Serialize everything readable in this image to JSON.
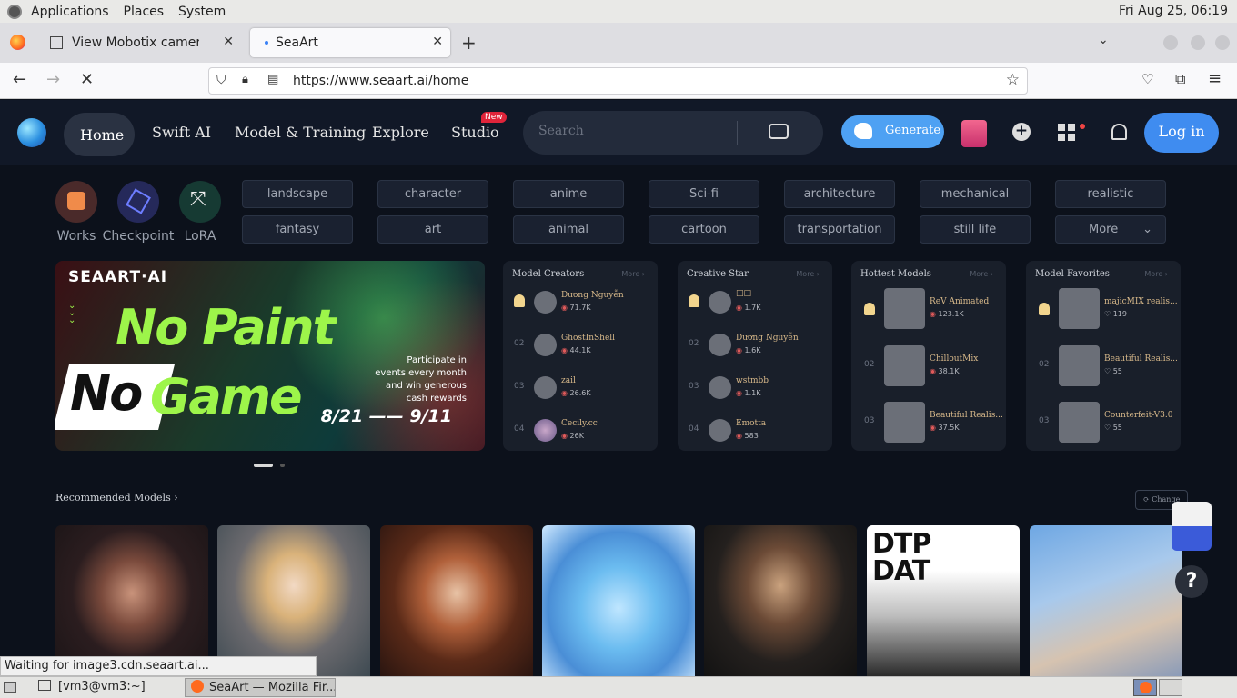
{
  "desktop": {
    "menus": [
      "Applications",
      "Places",
      "System"
    ],
    "clock": "Fri Aug 25, 06:19"
  },
  "browser": {
    "tabs": [
      {
        "title": "View Mobotix camera in Bul"
      },
      {
        "title": "SeaArt"
      }
    ],
    "url": "https://www.seaart.ai/home",
    "status": "Waiting for image3.cdn.seaart.ai..."
  },
  "site": {
    "nav": [
      "Home",
      "Swift AI",
      "Model & Training",
      "Explore",
      "Studio"
    ],
    "new_badge": "New",
    "search_placeholder": "Search",
    "generate": "Generate",
    "login": "Log in",
    "categories": [
      "Works",
      "Checkpoint",
      "LoRA"
    ],
    "tags_row1": [
      "landscape",
      "character",
      "anime",
      "Sci-fi",
      "architecture",
      "mechanical",
      "realistic"
    ],
    "tags_row2": [
      "fantasy",
      "art",
      "animal",
      "cartoon",
      "transportation",
      "still life",
      "More"
    ],
    "banner": {
      "brand": "SEAART·AI",
      "line1": "No Paint",
      "line2a": "No",
      "line2b": "Game",
      "blurb1": "Participate in",
      "blurb2": "events every month",
      "blurb3": "and win generous",
      "blurb4": "cash rewards",
      "dates": "8/21 —— 9/11"
    },
    "panels": [
      {
        "title": "Model Creators",
        "more": "More",
        "rows": [
          {
            "rank": "",
            "name": "Dương Nguyễn",
            "stat": "71.7K"
          },
          {
            "rank": "02",
            "name": "GhostInShell",
            "stat": "44.1K"
          },
          {
            "rank": "03",
            "name": "zail",
            "stat": "26.6K"
          },
          {
            "rank": "04",
            "name": "Cecily.cc",
            "stat": "26K"
          }
        ]
      },
      {
        "title": "Creative Star",
        "more": "More",
        "rows": [
          {
            "rank": "",
            "name": "□□",
            "stat": "1.7K"
          },
          {
            "rank": "02",
            "name": "Dương Nguyễn",
            "stat": "1.6K"
          },
          {
            "rank": "03",
            "name": "wstmbb",
            "stat": "1.1K"
          },
          {
            "rank": "04",
            "name": "Emotta",
            "stat": "583"
          }
        ]
      },
      {
        "title": "Hottest Models",
        "more": "More",
        "rows": [
          {
            "rank": "",
            "name": "ReV Animated",
            "stat": "123.1K"
          },
          {
            "rank": "02",
            "name": "ChilloutMix",
            "stat": "38.1K"
          },
          {
            "rank": "03",
            "name": "Beautiful Realis...",
            "stat": "37.5K"
          }
        ]
      },
      {
        "title": "Model Favorites",
        "more": "More",
        "rows": [
          {
            "rank": "",
            "name": "majicMIX realis...",
            "stat": "119"
          },
          {
            "rank": "02",
            "name": "Beautiful Realis...",
            "stat": "55"
          },
          {
            "rank": "03",
            "name": "Counterfeit-V3.0",
            "stat": "55"
          }
        ]
      }
    ],
    "recommended": "Recommended Models",
    "change": "Change",
    "help": "?"
  },
  "taskbar": {
    "items": [
      "[vm3@vm3:~]",
      "SeaArt — Mozilla Fir..."
    ]
  }
}
